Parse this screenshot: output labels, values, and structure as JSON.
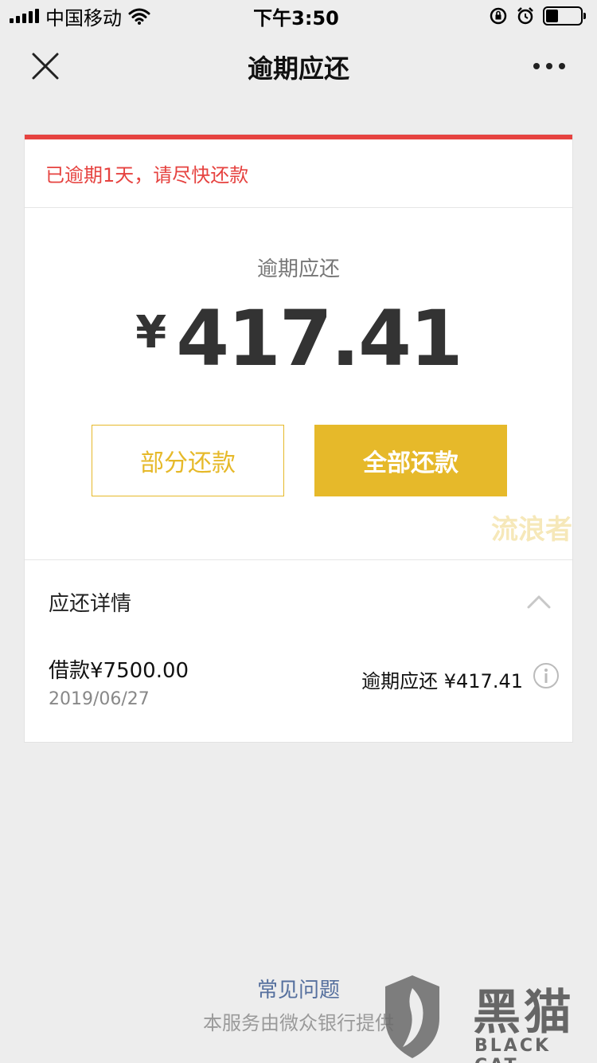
{
  "status_bar": {
    "carrier": "中国移动",
    "time": "下午3:50",
    "battery_level": 0.35
  },
  "nav": {
    "title": "逾期应还"
  },
  "notice": {
    "text": "已逾期1天，请尽快还款"
  },
  "amount": {
    "label": "逾期应还",
    "currency": "¥",
    "value": "417.41"
  },
  "actions": {
    "partial_label": "部分还款",
    "full_label": "全部还款"
  },
  "watermark": {
    "text": "流浪者"
  },
  "details": {
    "title": "应还详情",
    "loan": {
      "amount": "借款¥7500.00",
      "date": "2019/06/27",
      "due": "逾期应还 ¥417.41"
    }
  },
  "footer": {
    "faq": "常见问题",
    "provider": "本服务由微众银行提供"
  },
  "brand_watermark": {
    "cn": "黑猫",
    "en": "BLACK CAT"
  },
  "colors": {
    "accent_gold": "#e6b92a",
    "overdue_red": "#e64340",
    "link_blue": "#56709e"
  }
}
